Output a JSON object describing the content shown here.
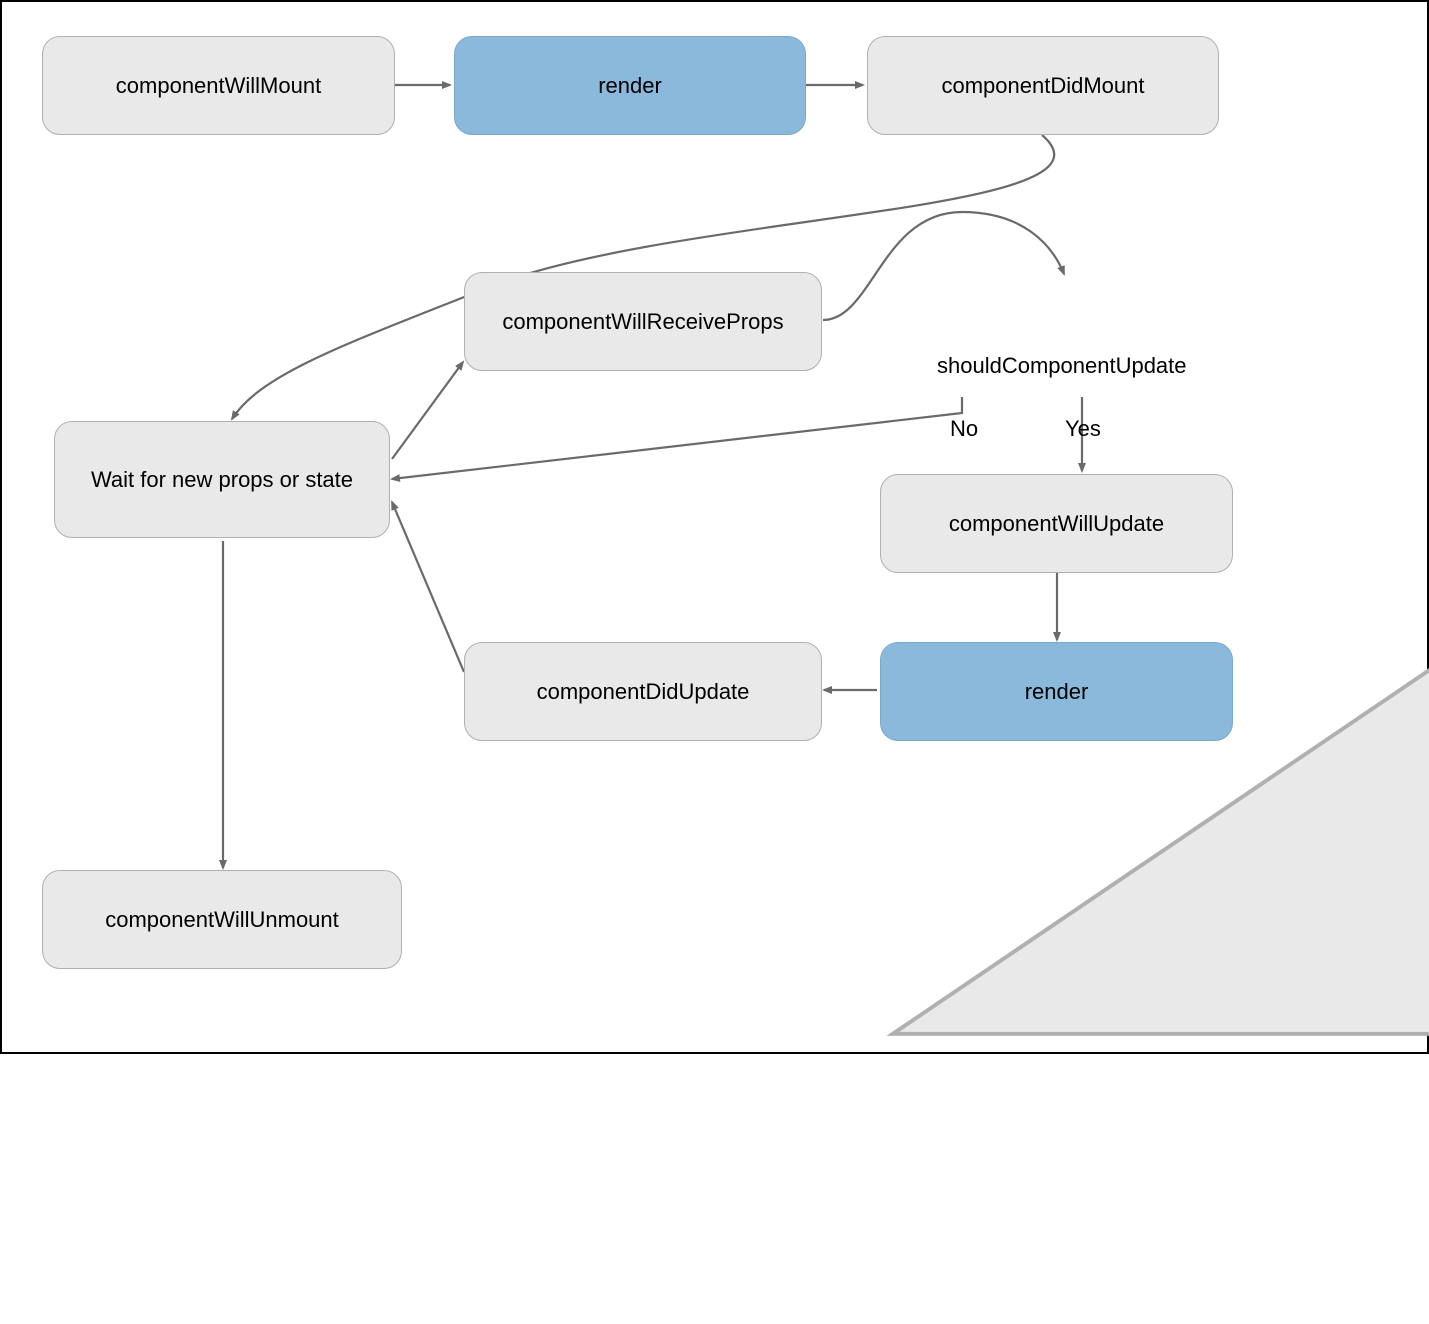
{
  "nodes": {
    "componentWillMount": "componentWillMount",
    "render1": "render",
    "componentDidMount": "componentDidMount",
    "componentWillReceiveProps": "componentWillReceiveProps",
    "shouldComponentUpdate": "shouldComponentUpdate",
    "waitState": "Wait for new props or state",
    "componentWillUpdate": "componentWillUpdate",
    "componentDidUpdate": "componentDidUpdate",
    "render2": "render",
    "componentWillUnmount": "componentWillUnmount"
  },
  "labels": {
    "no": "No",
    "yes": "Yes"
  },
  "colors": {
    "nodeGray": "#e9e9e9",
    "nodeBlue": "#8ab9dc",
    "arrow": "#6a6a6a",
    "border": "#b0b0b0"
  }
}
